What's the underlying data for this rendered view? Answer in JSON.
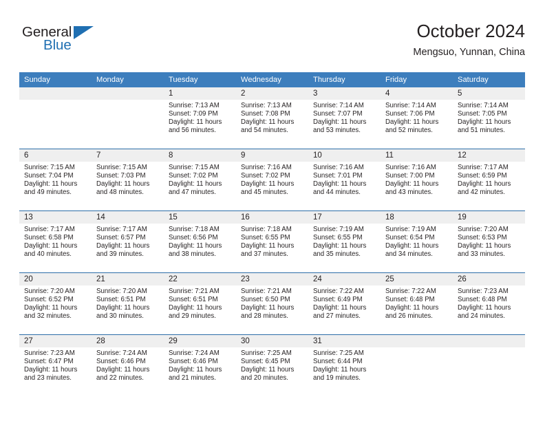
{
  "brand": {
    "name_part1": "General",
    "name_part2": "Blue",
    "triangle_color": "#1f6fb2"
  },
  "header": {
    "title": "October 2024",
    "subtitle": "Mengsuo, Yunnan, China"
  },
  "theme": {
    "header_blue": "#3d7ebd",
    "row_divider_blue": "#2b6da8",
    "daynum_band": "#efefef",
    "text": "#231f20"
  },
  "weekdays": [
    "Sunday",
    "Monday",
    "Tuesday",
    "Wednesday",
    "Thursday",
    "Friday",
    "Saturday"
  ],
  "weeks": [
    [
      {
        "day": "",
        "sunrise": "",
        "sunset": "",
        "daylight1": "",
        "daylight2": ""
      },
      {
        "day": "",
        "sunrise": "",
        "sunset": "",
        "daylight1": "",
        "daylight2": ""
      },
      {
        "day": "1",
        "sunrise": "Sunrise: 7:13 AM",
        "sunset": "Sunset: 7:09 PM",
        "daylight1": "Daylight: 11 hours",
        "daylight2": "and 56 minutes."
      },
      {
        "day": "2",
        "sunrise": "Sunrise: 7:13 AM",
        "sunset": "Sunset: 7:08 PM",
        "daylight1": "Daylight: 11 hours",
        "daylight2": "and 54 minutes."
      },
      {
        "day": "3",
        "sunrise": "Sunrise: 7:14 AM",
        "sunset": "Sunset: 7:07 PM",
        "daylight1": "Daylight: 11 hours",
        "daylight2": "and 53 minutes."
      },
      {
        "day": "4",
        "sunrise": "Sunrise: 7:14 AM",
        "sunset": "Sunset: 7:06 PM",
        "daylight1": "Daylight: 11 hours",
        "daylight2": "and 52 minutes."
      },
      {
        "day": "5",
        "sunrise": "Sunrise: 7:14 AM",
        "sunset": "Sunset: 7:05 PM",
        "daylight1": "Daylight: 11 hours",
        "daylight2": "and 51 minutes."
      }
    ],
    [
      {
        "day": "6",
        "sunrise": "Sunrise: 7:15 AM",
        "sunset": "Sunset: 7:04 PM",
        "daylight1": "Daylight: 11 hours",
        "daylight2": "and 49 minutes."
      },
      {
        "day": "7",
        "sunrise": "Sunrise: 7:15 AM",
        "sunset": "Sunset: 7:03 PM",
        "daylight1": "Daylight: 11 hours",
        "daylight2": "and 48 minutes."
      },
      {
        "day": "8",
        "sunrise": "Sunrise: 7:15 AM",
        "sunset": "Sunset: 7:02 PM",
        "daylight1": "Daylight: 11 hours",
        "daylight2": "and 47 minutes."
      },
      {
        "day": "9",
        "sunrise": "Sunrise: 7:16 AM",
        "sunset": "Sunset: 7:02 PM",
        "daylight1": "Daylight: 11 hours",
        "daylight2": "and 45 minutes."
      },
      {
        "day": "10",
        "sunrise": "Sunrise: 7:16 AM",
        "sunset": "Sunset: 7:01 PM",
        "daylight1": "Daylight: 11 hours",
        "daylight2": "and 44 minutes."
      },
      {
        "day": "11",
        "sunrise": "Sunrise: 7:16 AM",
        "sunset": "Sunset: 7:00 PM",
        "daylight1": "Daylight: 11 hours",
        "daylight2": "and 43 minutes."
      },
      {
        "day": "12",
        "sunrise": "Sunrise: 7:17 AM",
        "sunset": "Sunset: 6:59 PM",
        "daylight1": "Daylight: 11 hours",
        "daylight2": "and 42 minutes."
      }
    ],
    [
      {
        "day": "13",
        "sunrise": "Sunrise: 7:17 AM",
        "sunset": "Sunset: 6:58 PM",
        "daylight1": "Daylight: 11 hours",
        "daylight2": "and 40 minutes."
      },
      {
        "day": "14",
        "sunrise": "Sunrise: 7:17 AM",
        "sunset": "Sunset: 6:57 PM",
        "daylight1": "Daylight: 11 hours",
        "daylight2": "and 39 minutes."
      },
      {
        "day": "15",
        "sunrise": "Sunrise: 7:18 AM",
        "sunset": "Sunset: 6:56 PM",
        "daylight1": "Daylight: 11 hours",
        "daylight2": "and 38 minutes."
      },
      {
        "day": "16",
        "sunrise": "Sunrise: 7:18 AM",
        "sunset": "Sunset: 6:55 PM",
        "daylight1": "Daylight: 11 hours",
        "daylight2": "and 37 minutes."
      },
      {
        "day": "17",
        "sunrise": "Sunrise: 7:19 AM",
        "sunset": "Sunset: 6:55 PM",
        "daylight1": "Daylight: 11 hours",
        "daylight2": "and 35 minutes."
      },
      {
        "day": "18",
        "sunrise": "Sunrise: 7:19 AM",
        "sunset": "Sunset: 6:54 PM",
        "daylight1": "Daylight: 11 hours",
        "daylight2": "and 34 minutes."
      },
      {
        "day": "19",
        "sunrise": "Sunrise: 7:20 AM",
        "sunset": "Sunset: 6:53 PM",
        "daylight1": "Daylight: 11 hours",
        "daylight2": "and 33 minutes."
      }
    ],
    [
      {
        "day": "20",
        "sunrise": "Sunrise: 7:20 AM",
        "sunset": "Sunset: 6:52 PM",
        "daylight1": "Daylight: 11 hours",
        "daylight2": "and 32 minutes."
      },
      {
        "day": "21",
        "sunrise": "Sunrise: 7:20 AM",
        "sunset": "Sunset: 6:51 PM",
        "daylight1": "Daylight: 11 hours",
        "daylight2": "and 30 minutes."
      },
      {
        "day": "22",
        "sunrise": "Sunrise: 7:21 AM",
        "sunset": "Sunset: 6:51 PM",
        "daylight1": "Daylight: 11 hours",
        "daylight2": "and 29 minutes."
      },
      {
        "day": "23",
        "sunrise": "Sunrise: 7:21 AM",
        "sunset": "Sunset: 6:50 PM",
        "daylight1": "Daylight: 11 hours",
        "daylight2": "and 28 minutes."
      },
      {
        "day": "24",
        "sunrise": "Sunrise: 7:22 AM",
        "sunset": "Sunset: 6:49 PM",
        "daylight1": "Daylight: 11 hours",
        "daylight2": "and 27 minutes."
      },
      {
        "day": "25",
        "sunrise": "Sunrise: 7:22 AM",
        "sunset": "Sunset: 6:48 PM",
        "daylight1": "Daylight: 11 hours",
        "daylight2": "and 26 minutes."
      },
      {
        "day": "26",
        "sunrise": "Sunrise: 7:23 AM",
        "sunset": "Sunset: 6:48 PM",
        "daylight1": "Daylight: 11 hours",
        "daylight2": "and 24 minutes."
      }
    ],
    [
      {
        "day": "27",
        "sunrise": "Sunrise: 7:23 AM",
        "sunset": "Sunset: 6:47 PM",
        "daylight1": "Daylight: 11 hours",
        "daylight2": "and 23 minutes."
      },
      {
        "day": "28",
        "sunrise": "Sunrise: 7:24 AM",
        "sunset": "Sunset: 6:46 PM",
        "daylight1": "Daylight: 11 hours",
        "daylight2": "and 22 minutes."
      },
      {
        "day": "29",
        "sunrise": "Sunrise: 7:24 AM",
        "sunset": "Sunset: 6:46 PM",
        "daylight1": "Daylight: 11 hours",
        "daylight2": "and 21 minutes."
      },
      {
        "day": "30",
        "sunrise": "Sunrise: 7:25 AM",
        "sunset": "Sunset: 6:45 PM",
        "daylight1": "Daylight: 11 hours",
        "daylight2": "and 20 minutes."
      },
      {
        "day": "31",
        "sunrise": "Sunrise: 7:25 AM",
        "sunset": "Sunset: 6:44 PM",
        "daylight1": "Daylight: 11 hours",
        "daylight2": "and 19 minutes."
      },
      {
        "day": "",
        "sunrise": "",
        "sunset": "",
        "daylight1": "",
        "daylight2": ""
      },
      {
        "day": "",
        "sunrise": "",
        "sunset": "",
        "daylight1": "",
        "daylight2": ""
      }
    ]
  ]
}
